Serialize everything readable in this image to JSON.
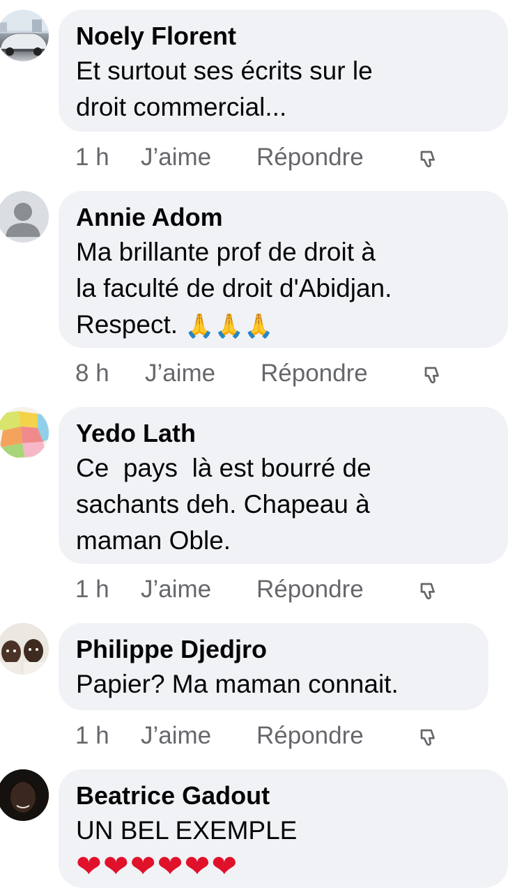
{
  "comments": [
    {
      "author": "Noely Florent",
      "text": "Et surtout ses écrits sur le\ndroit commercial...",
      "time": "1 h",
      "like": "J’aime",
      "reply": "Répondre",
      "avatar": "car-photo"
    },
    {
      "author": "Annie Adom",
      "text": "Ma brillante prof de droit à\nla faculté de droit d'Abidjan.\nRespect. ",
      "emoji": "🙏🙏🙏",
      "time": "8 h",
      "like": "J’aime",
      "reply": "Répondre",
      "avatar": "default-user"
    },
    {
      "author": "Yedo Lath",
      "text": "Ce  pays  là est bourré de\nsachants deh. Chapeau à\nmaman Oble.",
      "time": "1 h",
      "like": "J’aime",
      "reply": "Répondre",
      "avatar": "map-photo"
    },
    {
      "author": "Philippe Djedjro",
      "text": "Papier? Ma maman connait.",
      "time": "1 h",
      "like": "J’aime",
      "reply": "Répondre",
      "avatar": "children-photo"
    },
    {
      "author": "Beatrice Gadout",
      "text": "UN BEL EXEMPLE",
      "emoji": "❤❤❤❤❤❤",
      "avatar": "portrait-photo"
    }
  ],
  "colors": {
    "bubble": "#f0f2f5",
    "meta": "#65676b",
    "heart": "#e0112b"
  }
}
